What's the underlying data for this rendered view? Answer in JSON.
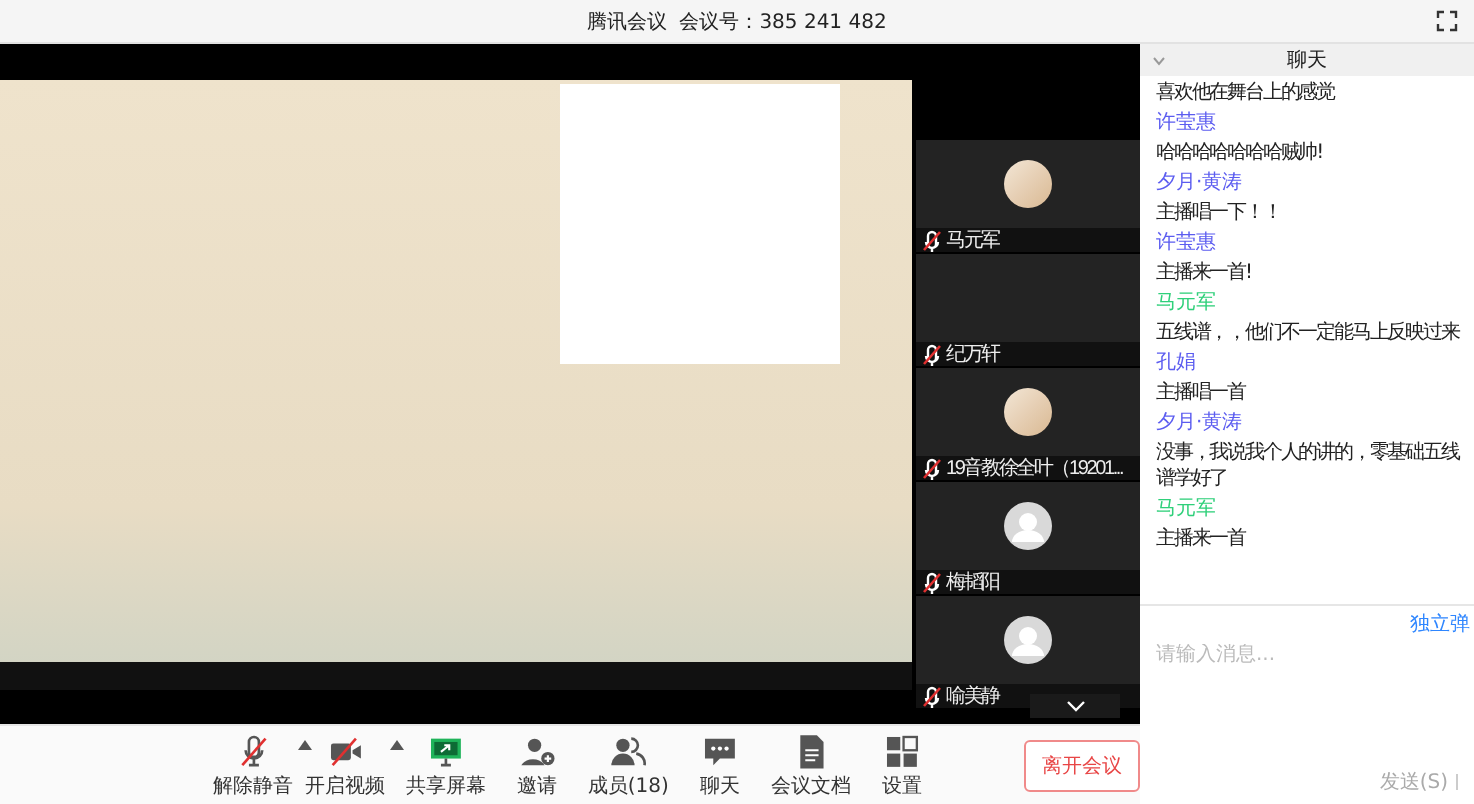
{
  "title_bar": {
    "app": "腾讯会议",
    "meeting_id": "会议号：385 241 482"
  },
  "participants": [
    {
      "name": "马元军",
      "kind": "photo",
      "muted": true
    },
    {
      "name": "纪万轩",
      "kind": "blank",
      "muted": true
    },
    {
      "name": "19音教徐全叶（19201...",
      "kind": "photo",
      "muted": true
    },
    {
      "name": "梅韬阳",
      "kind": "generic",
      "muted": true
    },
    {
      "name": "喻美静",
      "kind": "generic",
      "muted": true
    }
  ],
  "chat": {
    "title": "聊天",
    "messages": [
      {
        "text": "喜欢他在舞台上的感觉"
      },
      {
        "sender": "许莹惠",
        "color": "#5b5cf0",
        "text": "哈哈哈哈哈哈哈贼帅!"
      },
      {
        "sender": "夕月·黄涛",
        "color": "#5b5cf0",
        "text": "主播唱一下！！"
      },
      {
        "sender": "许莹惠",
        "color": "#5b5cf0",
        "text": "主播来一首!"
      },
      {
        "sender": "马元军",
        "color": "#2fd07a",
        "text": "五线谱，，他们不一定能马上反映过来"
      },
      {
        "sender": "孔娟",
        "color": "#5b5cf0",
        "text": "主播唱一首"
      },
      {
        "sender": "夕月·黄涛",
        "color": "#5b5cf0",
        "text": "没事，我说我个人的讲的，零基础五线谱学好了"
      },
      {
        "sender": "马元军",
        "color": "#2fd07a",
        "text": "主播来一首"
      }
    ],
    "popout_link": "独立弹",
    "placeholder": "请输入消息...",
    "send": "发送(S)"
  },
  "toolbar": [
    {
      "kind": "mic",
      "label": "解除静音",
      "caret": true
    },
    {
      "kind": "video",
      "label": "开启视频",
      "caret": true
    },
    {
      "kind": "share",
      "label": "共享屏幕",
      "caret": false
    },
    {
      "kind": "invite",
      "label": "邀请",
      "caret": false
    },
    {
      "kind": "members",
      "label": "成员(18)",
      "caret": false
    },
    {
      "kind": "chat",
      "label": "聊天",
      "caret": false
    },
    {
      "kind": "docs",
      "label": "会议文档",
      "caret": false
    },
    {
      "kind": "settings",
      "label": "设置",
      "caret": false
    }
  ],
  "leave_button": "离开会议"
}
